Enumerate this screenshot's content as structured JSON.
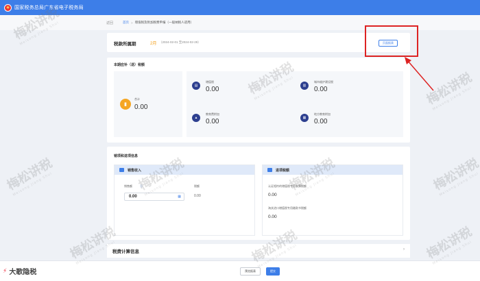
{
  "header": {
    "title": "国家税务总局广东省电子税务局",
    "logo_glyph": "★"
  },
  "breadcrumb": {
    "back": "返回",
    "home": "首页",
    "separator": ">",
    "current": "增值税及附加税费申报（一般纳税人适用）"
  },
  "summary": {
    "title": "税款所属期",
    "count": "2月",
    "period": "（2024-02-01 至2024-02-29）",
    "pdf_button": "页面报表"
  },
  "tax": {
    "section_title": "本期应补（退）税额",
    "total_label": "合计",
    "total_value": "0.00",
    "items": [
      {
        "label": "增值税",
        "value": "0.00",
        "icon": "vat-icon"
      },
      {
        "label": "城市维护建设税",
        "value": "0.00",
        "icon": "building-icon"
      },
      {
        "label": "教育费附加",
        "value": "0.00",
        "icon": "education-icon"
      },
      {
        "label": "地方教育附加",
        "value": "0.00",
        "icon": "book-icon"
      }
    ]
  },
  "sales": {
    "section_title": "销项和进项信息",
    "sales_panel": {
      "title": "销售收入",
      "taxfree_label": "销售额",
      "taxfree_value": "0.00",
      "tax_label": "税额",
      "tax_value": "0.00"
    },
    "input_panel": {
      "title": "进项税额",
      "line1_label": "认证相符的增值税专用发票税额",
      "line1_value": "0.00",
      "line2_label": "海关进口增值税专用缴款书税额",
      "line2_value": "0.00"
    }
  },
  "calc": {
    "title": "税费计算信息",
    "chevron": "›"
  },
  "footer": {
    "prev_button": "预览报表",
    "submit_button": "提交",
    "brand": "大歌隐税",
    "brand_icon": "⚡"
  },
  "watermark": {
    "text": "梅松讲税",
    "sub": "Meisong Jiang Shui"
  },
  "colors": {
    "accent": "#3d7ee8",
    "highlight": "#d22",
    "total_icon": "#f5a623",
    "tax_icon": "#2d3f8f"
  }
}
